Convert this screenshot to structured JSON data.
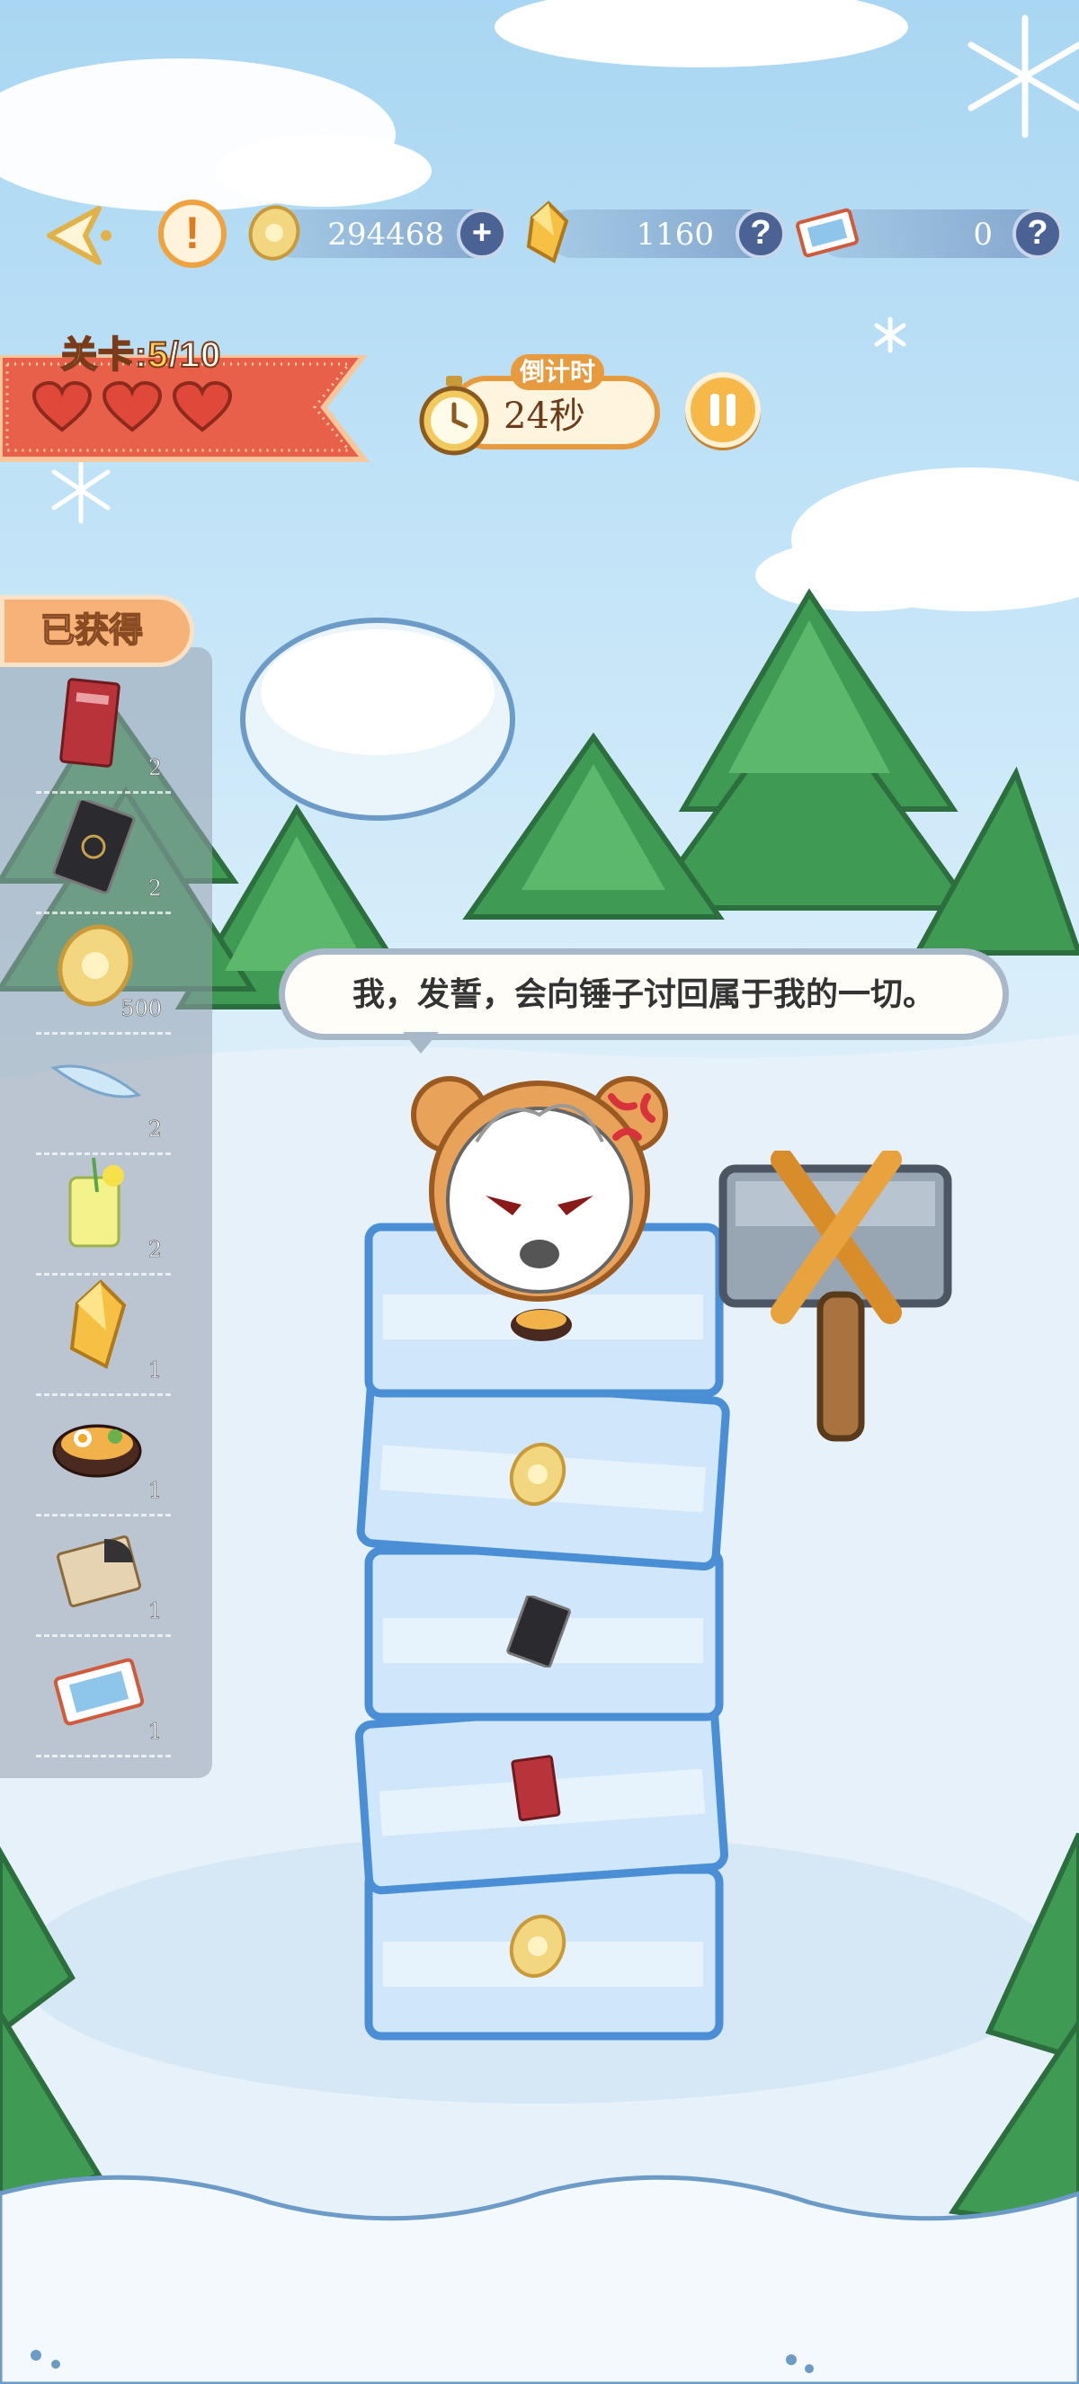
{
  "topbar": {
    "coins": "294468",
    "crystals": "1160",
    "tickets": "0",
    "coins_add": "+",
    "crystals_help": "?",
    "tickets_help": "?",
    "info_symbol": "!"
  },
  "level": {
    "label": "关卡:",
    "current": "5",
    "total": "/10",
    "lives": 3
  },
  "timer": {
    "label": "倒计时",
    "value": "24秒"
  },
  "obtained": {
    "title": "已获得",
    "items": [
      {
        "icon": "red-card-icon",
        "count": "2"
      },
      {
        "icon": "black-card-icon",
        "count": "2"
      },
      {
        "icon": "gold-coin-icon",
        "count": "500"
      },
      {
        "icon": "feather-icon",
        "count": "2"
      },
      {
        "icon": "lemonade-icon",
        "count": "2"
      },
      {
        "icon": "amber-crystal-icon",
        "count": "1"
      },
      {
        "icon": "ramen-bowl-icon",
        "count": "1"
      },
      {
        "icon": "scroll-note-icon",
        "count": "1"
      },
      {
        "icon": "ticket-icon",
        "count": "1"
      }
    ]
  },
  "dialog": {
    "text": "我，发誓，会向锤子讨回属于我的一切。"
  },
  "tower": {
    "blocks": [
      "ramen-bowl-icon",
      "gold-coin-icon",
      "black-card-icon",
      "red-card-icon",
      "gold-coin-icon"
    ]
  },
  "colors": {
    "accent": "#e89a3e",
    "ice": "#cfe6fb",
    "ice_border": "#4a8fd6",
    "heart": "#e0483a"
  }
}
